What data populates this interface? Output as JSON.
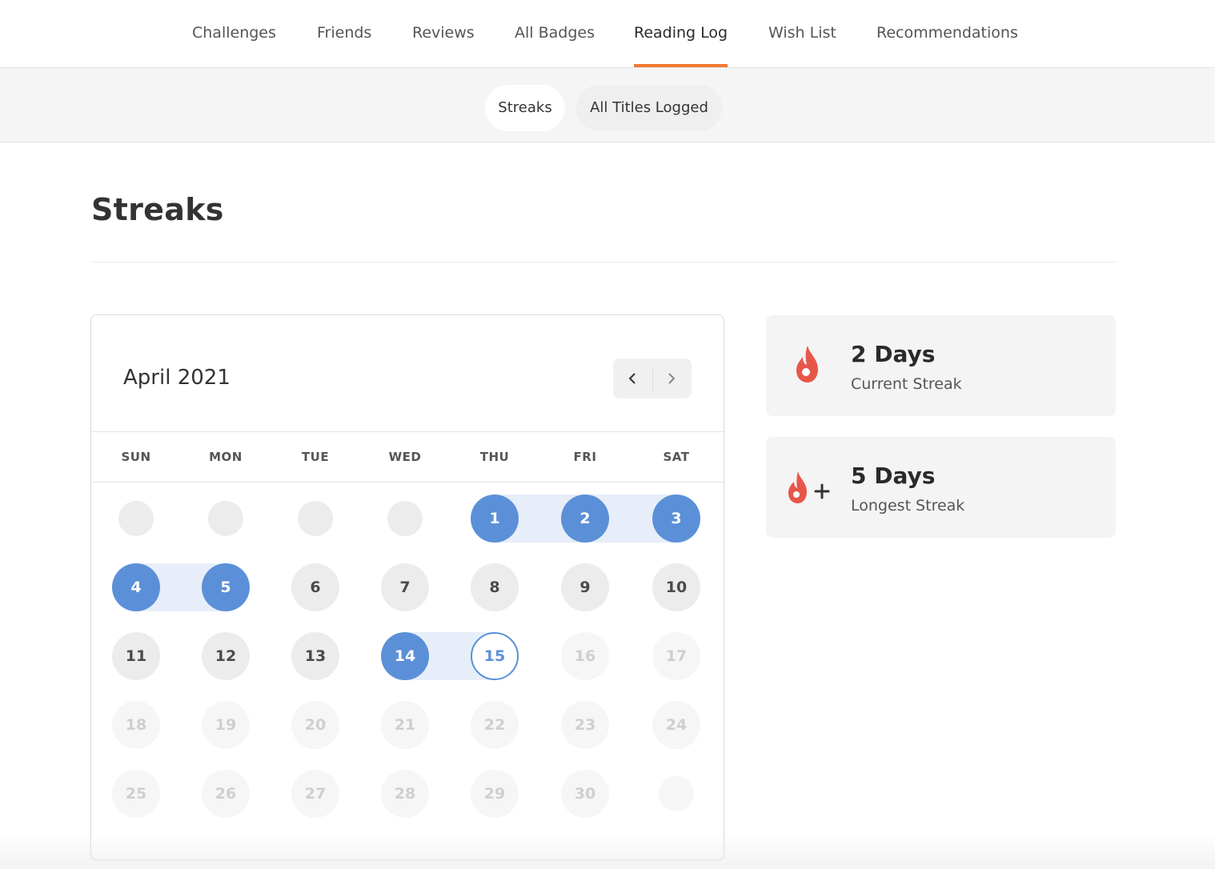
{
  "nav": {
    "tabs": [
      {
        "label": "Challenges"
      },
      {
        "label": "Friends"
      },
      {
        "label": "Reviews"
      },
      {
        "label": "All Badges"
      },
      {
        "label": "Reading Log",
        "active": true
      },
      {
        "label": "Wish List"
      },
      {
        "label": "Recommendations"
      }
    ]
  },
  "subnav": {
    "pills": [
      {
        "label": "Streaks",
        "active": true
      },
      {
        "label": "All Titles Logged"
      }
    ]
  },
  "page": {
    "title": "Streaks"
  },
  "calendar": {
    "month_label": "April 2021",
    "weekdays": [
      "SUN",
      "MON",
      "TUE",
      "WED",
      "THU",
      "FRI",
      "SAT"
    ],
    "leading_blank_days": 4,
    "days_in_month": 30,
    "today": 15,
    "read_days": [
      1,
      2,
      3,
      4,
      5,
      14,
      15
    ],
    "streak_ranges": [
      [
        1,
        3
      ],
      [
        4,
        5
      ],
      [
        14,
        15
      ]
    ]
  },
  "stats": {
    "current": {
      "value": "2 Days",
      "label": "Current Streak"
    },
    "longest": {
      "value": "5 Days",
      "label": "Longest Streak"
    }
  },
  "colors": {
    "accent": "#ef7a33",
    "read_day": "#5b90d8",
    "streak_range": "#e7eef9",
    "flame": "#e6574a"
  },
  "icons": {
    "current_streak": "flame-icon",
    "longest_streak": "flame-plus-icon",
    "prev": "chevron-left-icon",
    "next": "chevron-right-icon"
  }
}
